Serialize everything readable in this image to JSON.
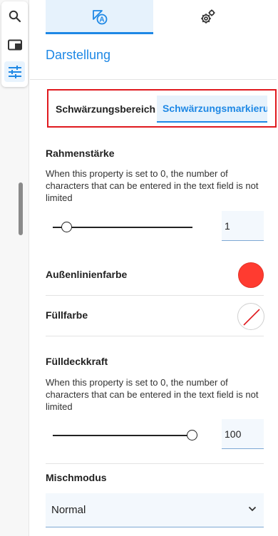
{
  "toolbar": {
    "items": [
      {
        "icon": "search-icon"
      },
      {
        "icon": "panel-icon"
      },
      {
        "icon": "sliders-icon",
        "active": true
      }
    ]
  },
  "tabs": [
    {
      "icon": "annotation-shapes-icon",
      "active": true
    },
    {
      "icon": "gears-icon",
      "active": false
    }
  ],
  "section": {
    "title": "Darstellung"
  },
  "subtabs": [
    {
      "label": "Schwärzungsbereich",
      "active": false
    },
    {
      "label": "Schwärzungsmarkierung",
      "active": true
    }
  ],
  "border_width": {
    "label": "Rahmenstärke",
    "description": "When this property is set to 0, the number of characters that can be entered in the text field is not limited",
    "value": "1"
  },
  "outline_color": {
    "label": "Außenlinienfarbe",
    "color": "#ff3b30"
  },
  "fill_color": {
    "label": "Füllfarbe",
    "value": "none"
  },
  "fill_opacity": {
    "label": "Fülldeckkraft",
    "description": "When this property is set to 0, the number of characters that can be entered in the text field is not limited",
    "value": "100"
  },
  "blend_mode": {
    "label": "Mischmodus",
    "value": "Normal"
  },
  "colors": {
    "accent": "#1e88e5",
    "highlight_frame": "#e0191e"
  }
}
